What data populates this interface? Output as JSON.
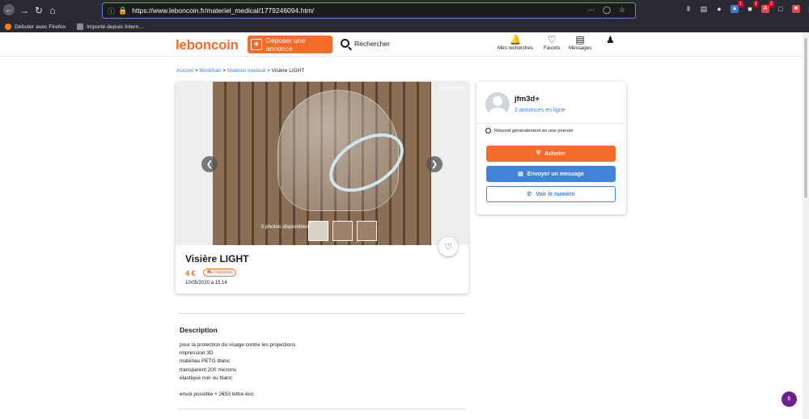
{
  "browser": {
    "url": "https://www.leboncoin.fr/materiel_medical/1779246094.htm/",
    "bookmarks": [
      "Débuter avec Firefox",
      "Importé depuis Intern..."
    ],
    "icons": {
      "back": "back-arrow-icon",
      "forward": "forward-arrow-icon",
      "reload": "reload-icon",
      "home": "home-icon"
    },
    "badges": {
      "b1": "1",
      "b2": "1",
      "b3": "2"
    }
  },
  "header": {
    "logo": "leboncoin",
    "post_ad": "Déposer une annonce",
    "search": "Rechercher",
    "nav": [
      {
        "label": "Mes recherches",
        "icon": "bell-icon"
      },
      {
        "label": "Favoris",
        "icon": "heart-icon"
      },
      {
        "label": "Messages",
        "icon": "message-icon"
      },
      {
        "label": "",
        "icon": "user-icon"
      }
    ]
  },
  "breadcrumb": [
    "Accueil",
    "Morbihan",
    "Matériel médical",
    "Visière LIGHT"
  ],
  "listing": {
    "watermark": "leboncoin",
    "photos_count": "3 photos disponibles",
    "title": "Visière LIGHT",
    "price": "4 €",
    "delivery": "Livraison",
    "date": "10/05/2020 à 15:14"
  },
  "description": {
    "heading": "Description",
    "lines": [
      "pour la protection du visage contre les projections",
      "impression 3D",
      "matériau PETG blanc",
      "transparent 200 microns",
      "élastique noir ou blanc",
      "",
      "envoi possible + 2€50 lettre éco"
    ]
  },
  "seller": {
    "name": "jfm3d+",
    "ads": "2 annonces en ligne",
    "response": "Répond généralement en une journée",
    "buy": "Acheter",
    "message": "Envoyer un message",
    "phone": "Voir le numéro"
  },
  "chat_badge": "6",
  "colors": {
    "brand": "#f56b2a",
    "link": "#4183d7"
  }
}
